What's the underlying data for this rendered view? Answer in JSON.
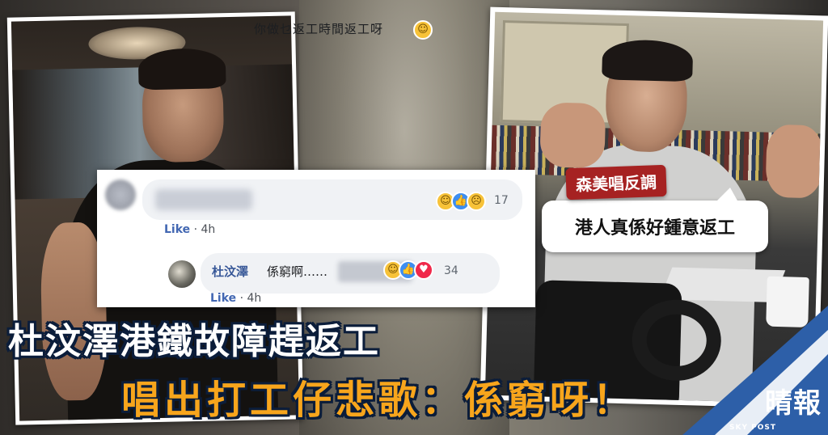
{
  "comment1": {
    "text": "你做乜返工時間返工呀",
    "reaction_count": "17",
    "like_label": "Like",
    "time": "4h"
  },
  "comment2": {
    "author": "杜汶澤",
    "text": "係窮啊……",
    "reaction_count": "34",
    "like_label": "Like",
    "time": "4h"
  },
  "bubble": {
    "tag": "森美唱反調",
    "quote": "港人真係好鍾意返工"
  },
  "headline": {
    "line1": "杜汶澤港鐵故障趕返工",
    "line2": "唱出打工仔悲歌：係窮呀！"
  },
  "brand": {
    "name": "晴報",
    "sub": "SKY POST"
  },
  "colors": {
    "headline_orange": "#f7a51c",
    "tag_red": "#a62222",
    "fb_link_blue": "#385898"
  }
}
